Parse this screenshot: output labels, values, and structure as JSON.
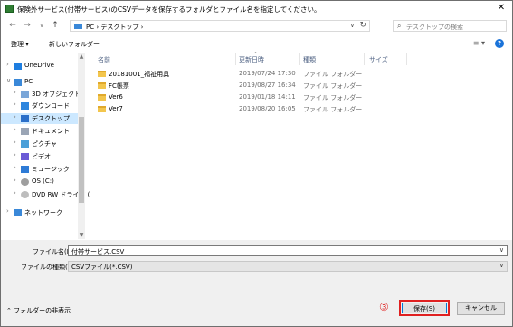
{
  "window": {
    "title": "保険外サービス(付帯サービス)のCSVデータを保存するフォルダとファイル名を指定してください。",
    "close_glyph": "✕"
  },
  "nav": {
    "back": "←",
    "forward": "→",
    "recent": "∨",
    "up": "↑",
    "breadcrumbs": "PC  ›  デスクトップ  ›",
    "address_dropdown": "∨",
    "refresh": "↻",
    "search_placeholder": "デスクトップの検索"
  },
  "toolbar": {
    "organize": "整理 ▾",
    "new_folder": "新しいフォルダー",
    "view": "≡ ▾",
    "help": "?"
  },
  "tree": {
    "items": [
      {
        "label": "OneDrive",
        "icon": "cloud-icon",
        "arrow": "›"
      },
      {
        "label": "PC",
        "icon": "pc-icon",
        "arrow": "∨"
      },
      {
        "label": "3D オブジェクト",
        "icon": "cube-icon",
        "arrow": "›"
      },
      {
        "label": "ダウンロード",
        "icon": "download-icon",
        "arrow": "›"
      },
      {
        "label": "デスクトップ",
        "icon": "desktop-icon",
        "arrow": "›"
      },
      {
        "label": "ドキュメント",
        "icon": "document-icon",
        "arrow": "›"
      },
      {
        "label": "ピクチャ",
        "icon": "picture-icon",
        "arrow": "›"
      },
      {
        "label": "ビデオ",
        "icon": "video-icon",
        "arrow": "›"
      },
      {
        "label": "ミュージック",
        "icon": "music-icon",
        "arrow": "›"
      },
      {
        "label": "OS (C:)",
        "icon": "drive-icon",
        "arrow": "›"
      },
      {
        "label": "DVD RW ドライブ (",
        "icon": "dvd-icon",
        "arrow": "›"
      },
      {
        "label": "ネットワーク",
        "icon": "network-icon",
        "arrow": "›"
      }
    ]
  },
  "columns": {
    "name": "名前",
    "modified": "更新日時",
    "type": "種類",
    "size": "サイズ",
    "sort_chevron": "^"
  },
  "files": [
    {
      "name": "20181001_福祉用具",
      "date": "2019/07/24 17:30",
      "type": "ファイル フォルダー"
    },
    {
      "name": "FC帳票",
      "date": "2019/08/27 16:34",
      "type": "ファイル フォルダー"
    },
    {
      "name": "Ver6",
      "date": "2019/01/18 14:11",
      "type": "ファイル フォルダー"
    },
    {
      "name": "Ver7",
      "date": "2019/08/20 16:05",
      "type": "ファイル フォルダー"
    }
  ],
  "form": {
    "filename_label": "ファイル名(N):",
    "filename_value": "付帯サービス.CSV",
    "filetype_label": "ファイルの種類(T):",
    "filetype_value": "CSVファイル(*.CSV)",
    "dropdown_glyph": "∨",
    "hide_folders": "フォルダーの非表示",
    "hide_folders_glyph": "⌃",
    "step_marker": "③",
    "save": "保存(S)",
    "cancel": "キャンセル"
  },
  "scroll": {
    "up": "▲",
    "down": "▼"
  },
  "colors": {
    "accent": "#0078d7",
    "highlight": "#e02020",
    "selected": "#cce8ff"
  }
}
